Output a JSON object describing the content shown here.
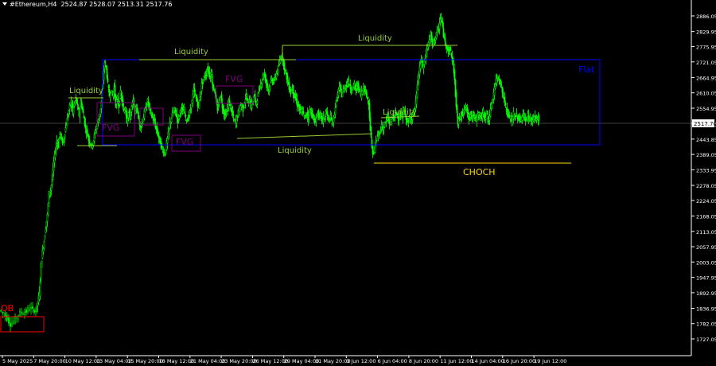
{
  "header": {
    "symbol": "#Ethereum,H4",
    "ohlc": "2524.87 2528.07 2513.31 2517.76"
  },
  "chart_data": {
    "type": "candlestick",
    "symbol": "#Ethereum",
    "timeframe": "H4",
    "open": 2524.87,
    "high": 2528.07,
    "low": 2513.31,
    "close": 2517.76,
    "current_price_label": "2517.76",
    "ylim": [
      1700,
      2930
    ],
    "y_ticks": [
      "2886.05",
      "2829.95",
      "2775.95",
      "2721.05",
      "2664.95",
      "2610.05",
      "2554.95",
      "2499.95",
      "2443.85",
      "2389.05",
      "2333.95",
      "2278.05",
      "2224.05",
      "2168.05",
      "2113.05",
      "2057.95",
      "2003.05",
      "1947.95",
      "1892.95",
      "1836.95",
      "1782.05",
      "1727.05"
    ],
    "x_ticks": [
      "5 May 2025",
      "7 May 20:00",
      "10 May 12:00",
      "13 May 04:00",
      "15 May 20:00",
      "18 May 12:00",
      "21 May 04:00",
      "23 May 20:00",
      "26 May 12:00",
      "29 May 04:00",
      "31 May 20:00",
      "3 Jun 12:00",
      "6 Jun 04:00",
      "8 Jun 20:00",
      "11 Jun 12:00",
      "14 Jun 04:00",
      "16 Jun 20:00",
      "19 Jun 12:00"
    ],
    "price_path": [
      [
        0,
        1830
      ],
      [
        5,
        1820
      ],
      [
        10,
        1800
      ],
      [
        14,
        1780
      ],
      [
        18,
        1790
      ],
      [
        22,
        1810
      ],
      [
        26,
        1820
      ],
      [
        30,
        1822
      ],
      [
        34,
        1825
      ],
      [
        38,
        1840
      ],
      [
        42,
        1830
      ],
      [
        46,
        1830
      ],
      [
        48,
        1860
      ],
      [
        50,
        1890
      ],
      [
        52,
        1990
      ],
      [
        54,
        2040
      ],
      [
        56,
        2080
      ],
      [
        58,
        2130
      ],
      [
        60,
        2170
      ],
      [
        62,
        2250
      ],
      [
        64,
        2260
      ],
      [
        66,
        2300
      ],
      [
        68,
        2360
      ],
      [
        70,
        2400
      ],
      [
        72,
        2440
      ],
      [
        74,
        2420
      ],
      [
        76,
        2470
      ],
      [
        78,
        2440
      ],
      [
        80,
        2430
      ],
      [
        82,
        2470
      ],
      [
        84,
        2500
      ],
      [
        86,
        2530
      ],
      [
        88,
        2560
      ],
      [
        90,
        2580
      ],
      [
        92,
        2540
      ],
      [
        94,
        2570
      ],
      [
        96,
        2590
      ],
      [
        98,
        2560
      ],
      [
        100,
        2530
      ],
      [
        102,
        2580
      ],
      [
        104,
        2550
      ],
      [
        106,
        2520
      ],
      [
        108,
        2480
      ],
      [
        110,
        2470
      ],
      [
        112,
        2440
      ],
      [
        114,
        2430
      ],
      [
        116,
        2420
      ],
      [
        118,
        2440
      ],
      [
        120,
        2470
      ],
      [
        122,
        2490
      ],
      [
        124,
        2510
      ],
      [
        126,
        2530
      ],
      [
        128,
        2580
      ],
      [
        130,
        2660
      ],
      [
        132,
        2720
      ],
      [
        134,
        2700
      ],
      [
        136,
        2640
      ],
      [
        138,
        2600
      ],
      [
        140,
        2620
      ],
      [
        142,
        2600
      ],
      [
        144,
        2630
      ],
      [
        146,
        2570
      ],
      [
        148,
        2590
      ],
      [
        150,
        2560
      ],
      [
        152,
        2610
      ],
      [
        154,
        2580
      ],
      [
        156,
        2540
      ],
      [
        158,
        2560
      ],
      [
        160,
        2510
      ],
      [
        162,
        2540
      ],
      [
        164,
        2520
      ],
      [
        166,
        2560
      ],
      [
        168,
        2580
      ],
      [
        170,
        2540
      ],
      [
        172,
        2560
      ],
      [
        174,
        2530
      ],
      [
        176,
        2500
      ],
      [
        178,
        2490
      ],
      [
        180,
        2510
      ],
      [
        182,
        2540
      ],
      [
        184,
        2560
      ],
      [
        186,
        2580
      ],
      [
        188,
        2560
      ],
      [
        190,
        2540
      ],
      [
        192,
        2520
      ],
      [
        194,
        2510
      ],
      [
        196,
        2490
      ],
      [
        198,
        2470
      ],
      [
        200,
        2450
      ],
      [
        202,
        2430
      ],
      [
        204,
        2410
      ],
      [
        206,
        2400
      ],
      [
        208,
        2390
      ],
      [
        210,
        2430
      ],
      [
        212,
        2460
      ],
      [
        214,
        2500
      ],
      [
        216,
        2520
      ],
      [
        218,
        2540
      ],
      [
        220,
        2550
      ],
      [
        222,
        2530
      ],
      [
        224,
        2510
      ],
      [
        226,
        2530
      ],
      [
        228,
        2560
      ],
      [
        230,
        2540
      ],
      [
        232,
        2550
      ],
      [
        234,
        2520
      ],
      [
        236,
        2510
      ],
      [
        238,
        2530
      ],
      [
        240,
        2550
      ],
      [
        242,
        2580
      ],
      [
        244,
        2620
      ],
      [
        246,
        2600
      ],
      [
        248,
        2580
      ],
      [
        250,
        2560
      ],
      [
        252,
        2600
      ],
      [
        254,
        2640
      ],
      [
        256,
        2660
      ],
      [
        258,
        2670
      ],
      [
        260,
        2680
      ],
      [
        262,
        2700
      ],
      [
        264,
        2670
      ],
      [
        266,
        2680
      ],
      [
        268,
        2630
      ],
      [
        270,
        2620
      ],
      [
        272,
        2580
      ],
      [
        274,
        2550
      ],
      [
        276,
        2580
      ],
      [
        278,
        2600
      ],
      [
        280,
        2560
      ],
      [
        282,
        2540
      ],
      [
        284,
        2530
      ],
      [
        286,
        2550
      ],
      [
        288,
        2580
      ],
      [
        290,
        2560
      ],
      [
        292,
        2540
      ],
      [
        294,
        2520
      ],
      [
        296,
        2500
      ],
      [
        298,
        2520
      ],
      [
        300,
        2540
      ],
      [
        302,
        2560
      ],
      [
        304,
        2570
      ],
      [
        306,
        2550
      ],
      [
        308,
        2580
      ],
      [
        310,
        2600
      ],
      [
        312,
        2570
      ],
      [
        314,
        2590
      ],
      [
        316,
        2560
      ],
      [
        318,
        2580
      ],
      [
        320,
        2600
      ],
      [
        322,
        2570
      ],
      [
        324,
        2590
      ],
      [
        326,
        2620
      ],
      [
        328,
        2640
      ],
      [
        330,
        2660
      ],
      [
        332,
        2680
      ],
      [
        334,
        2660
      ],
      [
        336,
        2640
      ],
      [
        338,
        2620
      ],
      [
        340,
        2640
      ],
      [
        342,
        2660
      ],
      [
        344,
        2650
      ],
      [
        346,
        2660
      ],
      [
        348,
        2680
      ],
      [
        350,
        2700
      ],
      [
        352,
        2720
      ],
      [
        354,
        2740
      ],
      [
        356,
        2730
      ],
      [
        358,
        2700
      ],
      [
        360,
        2680
      ],
      [
        362,
        2650
      ],
      [
        364,
        2630
      ],
      [
        366,
        2610
      ],
      [
        368,
        2630
      ],
      [
        370,
        2600
      ],
      [
        372,
        2590
      ],
      [
        374,
        2570
      ],
      [
        376,
        2560
      ],
      [
        378,
        2540
      ],
      [
        380,
        2550
      ],
      [
        382,
        2530
      ],
      [
        384,
        2520
      ],
      [
        386,
        2540
      ],
      [
        388,
        2520
      ],
      [
        390,
        2550
      ],
      [
        392,
        2540
      ],
      [
        394,
        2520
      ],
      [
        396,
        2500
      ],
      [
        398,
        2520
      ],
      [
        400,
        2540
      ],
      [
        402,
        2520
      ],
      [
        404,
        2530
      ],
      [
        406,
        2510
      ],
      [
        408,
        2520
      ],
      [
        410,
        2540
      ],
      [
        412,
        2530
      ],
      [
        414,
        2510
      ],
      [
        416,
        2520
      ],
      [
        418,
        2500
      ],
      [
        420,
        2520
      ],
      [
        422,
        2560
      ],
      [
        424,
        2590
      ],
      [
        426,
        2620
      ],
      [
        428,
        2630
      ],
      [
        430,
        2600
      ],
      [
        432,
        2620
      ],
      [
        434,
        2630
      ],
      [
        436,
        2640
      ],
      [
        438,
        2650
      ],
      [
        440,
        2640
      ],
      [
        442,
        2620
      ],
      [
        444,
        2630
      ],
      [
        446,
        2640
      ],
      [
        448,
        2620
      ],
      [
        450,
        2640
      ],
      [
        452,
        2620
      ],
      [
        454,
        2600
      ],
      [
        456,
        2620
      ],
      [
        458,
        2630
      ],
      [
        460,
        2610
      ],
      [
        462,
        2600
      ],
      [
        464,
        2570
      ],
      [
        466,
        2480
      ],
      [
        468,
        2410
      ],
      [
        470,
        2390
      ],
      [
        472,
        2420
      ],
      [
        474,
        2450
      ],
      [
        476,
        2460
      ],
      [
        478,
        2470
      ],
      [
        480,
        2490
      ],
      [
        482,
        2480
      ],
      [
        484,
        2500
      ],
      [
        486,
        2510
      ],
      [
        488,
        2520
      ],
      [
        490,
        2500
      ],
      [
        492,
        2510
      ],
      [
        494,
        2530
      ],
      [
        496,
        2520
      ],
      [
        498,
        2540
      ],
      [
        500,
        2530
      ],
      [
        502,
        2520
      ],
      [
        504,
        2530
      ],
      [
        506,
        2520
      ],
      [
        508,
        2550
      ],
      [
        510,
        2530
      ],
      [
        512,
        2510
      ],
      [
        514,
        2500
      ],
      [
        516,
        2530
      ],
      [
        518,
        2520
      ],
      [
        520,
        2540
      ],
      [
        522,
        2550
      ],
      [
        524,
        2600
      ],
      [
        526,
        2660
      ],
      [
        528,
        2700
      ],
      [
        530,
        2730
      ],
      [
        532,
        2700
      ],
      [
        534,
        2720
      ],
      [
        536,
        2750
      ],
      [
        538,
        2780
      ],
      [
        540,
        2800
      ],
      [
        542,
        2820
      ],
      [
        544,
        2780
      ],
      [
        546,
        2800
      ],
      [
        548,
        2810
      ],
      [
        550,
        2830
      ],
      [
        552,
        2840
      ],
      [
        554,
        2880
      ],
      [
        556,
        2860
      ],
      [
        558,
        2820
      ],
      [
        560,
        2790
      ],
      [
        562,
        2780
      ],
      [
        564,
        2760
      ],
      [
        566,
        2770
      ],
      [
        568,
        2740
      ],
      [
        570,
        2720
      ],
      [
        572,
        2650
      ],
      [
        574,
        2560
      ],
      [
        576,
        2500
      ],
      [
        578,
        2520
      ],
      [
        580,
        2540
      ],
      [
        582,
        2530
      ],
      [
        584,
        2550
      ],
      [
        586,
        2560
      ],
      [
        588,
        2540
      ],
      [
        590,
        2520
      ],
      [
        592,
        2540
      ],
      [
        594,
        2520
      ],
      [
        596,
        2530
      ],
      [
        598,
        2510
      ],
      [
        600,
        2520
      ],
      [
        602,
        2540
      ],
      [
        604,
        2530
      ],
      [
        606,
        2520
      ],
      [
        608,
        2540
      ],
      [
        610,
        2520
      ],
      [
        612,
        2540
      ],
      [
        614,
        2510
      ],
      [
        616,
        2530
      ],
      [
        618,
        2560
      ],
      [
        620,
        2590
      ],
      [
        622,
        2630
      ],
      [
        624,
        2650
      ],
      [
        626,
        2670
      ],
      [
        628,
        2660
      ],
      [
        630,
        2640
      ],
      [
        632,
        2610
      ],
      [
        634,
        2590
      ],
      [
        636,
        2560
      ],
      [
        638,
        2540
      ],
      [
        640,
        2520
      ],
      [
        642,
        2530
      ],
      [
        644,
        2500
      ],
      [
        646,
        2540
      ],
      [
        648,
        2520
      ],
      [
        650,
        2530
      ],
      [
        652,
        2520
      ],
      [
        654,
        2510
      ],
      [
        656,
        2520
      ],
      [
        658,
        2530
      ],
      [
        660,
        2520
      ],
      [
        662,
        2510
      ],
      [
        664,
        2530
      ],
      [
        666,
        2520
      ],
      [
        668,
        2515
      ],
      [
        670,
        2510
      ],
      [
        672,
        2525
      ],
      [
        674,
        2515
      ],
      [
        676,
        2520
      ],
      [
        678,
        2518
      ]
    ]
  },
  "annotations": {
    "liquidity_labels": [
      "Liquidity",
      "Liquidity",
      "Liquidity",
      "Liquidity",
      "Liquidity"
    ],
    "fvg_labels": [
      "FVG",
      "FVG",
      "FVG"
    ],
    "flat_label": "Flat",
    "choch_label": "CHOCH",
    "ob_label": "OB"
  },
  "colors": {
    "background": "#000000",
    "candle": "#00ff00",
    "liquidity": "#9acd32",
    "flat_box": "#0000ff",
    "flat_text": "#0000ff",
    "fvg_box": "#800080",
    "fvg_text": "#800080",
    "choch": "#ffd700",
    "ob": "#ff0000",
    "axis_text": "#ffffff",
    "price_line": "#808080"
  }
}
